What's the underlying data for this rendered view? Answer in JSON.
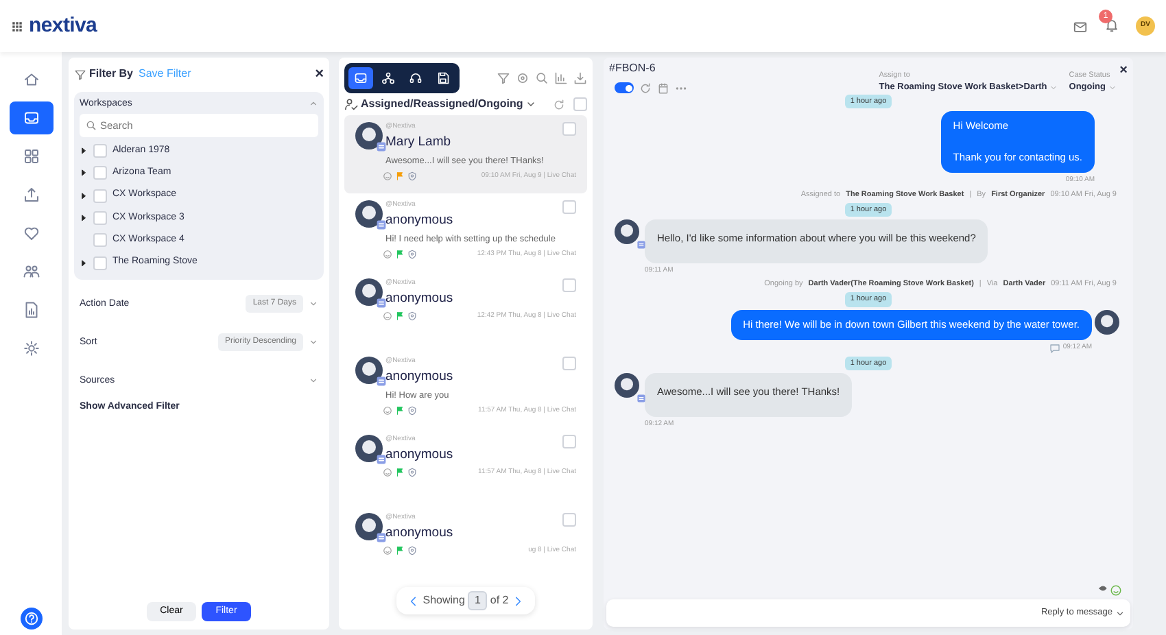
{
  "header": {
    "logo": "nextiva",
    "notifications": "1",
    "avatar": "DV"
  },
  "rail": {
    "items": [
      {
        "selected": false
      },
      {
        "selected": true
      },
      {
        "selected": false
      },
      {
        "selected": false
      },
      {
        "selected": false
      },
      {
        "selected": false
      },
      {
        "selected": false
      },
      {
        "selected": false
      }
    ]
  },
  "filter": {
    "title": "Filter By",
    "save": "Save Filter",
    "close": "×",
    "workspaces": {
      "title": "Workspaces",
      "expanded": true,
      "placeholder": "Search",
      "items": [
        {
          "label": "Alderan 1978",
          "expandable": true,
          "checked": false
        },
        {
          "label": "Arizona Team",
          "expandable": true,
          "checked": false
        },
        {
          "label": "CX Workspace",
          "expandable": true,
          "checked": false
        },
        {
          "label": "CX Workspace 3",
          "expandable": true,
          "checked": false
        },
        {
          "label": "CX Workspace 4",
          "expandable": false,
          "checked": false
        },
        {
          "label": "The Roaming Stove",
          "expandable": true,
          "checked": false
        }
      ]
    },
    "options": [
      {
        "label": "Action Date",
        "value": "Last 7 Days"
      },
      {
        "label": "Sort",
        "value": "Priority Descending"
      },
      {
        "label": "Sources"
      }
    ],
    "advanced": "Show Advanced Filter",
    "clear": "Clear",
    "apply": "Filter"
  },
  "list": {
    "tabs": [
      {
        "selected": true
      },
      {
        "selected": false
      },
      {
        "selected": false
      },
      {
        "selected": false
      }
    ],
    "view": "Assigned/Reassigned/Ongoing",
    "select_all_checked": false,
    "conversations": [
      {
        "source": "@Nextiva",
        "name": "Mary Lamb",
        "preview": "Awesome...I will see you there! THanks!",
        "color": "#f59e0b",
        "time": "09:10 AM Fri, Aug 9 | Live Chat",
        "selected": true,
        "checked": false
      },
      {
        "source": "@Nextiva",
        "name": "anonymous",
        "preview": "Hi! I need help with setting up the schedule",
        "color": "#22c55e",
        "time": "12:43 PM Thu, Aug 8 | Live Chat",
        "selected": false,
        "checked": false
      },
      {
        "source": "@Nextiva",
        "name": "anonymous",
        "color": "#22c55e",
        "time": "12:42 PM Thu, Aug 8 | Live Chat",
        "selected": false,
        "checked": false
      },
      {
        "source": "@Nextiva",
        "name": "anonymous",
        "preview": "Hi! How are you",
        "color": "#22c55e",
        "time": "11:57 AM Thu, Aug 8 | Live Chat",
        "selected": false,
        "checked": false
      },
      {
        "source": "@Nextiva",
        "name": "anonymous",
        "color": "#22c55e",
        "time": "11:57 AM Thu, Aug 8 | Live Chat",
        "selected": false,
        "checked": false
      },
      {
        "source": "@Nextiva",
        "name": "anonymous",
        "color": "#22c55e",
        "time": "ug 8 | Live Chat",
        "selected": false,
        "checked": false
      }
    ],
    "pager": {
      "label": "Showing",
      "page": "1",
      "total": "of 2"
    }
  },
  "chat": {
    "case": "#FBON-6",
    "close": "×",
    "live": true,
    "assign": {
      "label": "Assign to",
      "value": "The Roaming Stove Work Basket>Darth"
    },
    "status": {
      "label": "Case Status",
      "value": "Ongoing"
    },
    "messages": [
      {
        "kind": "divider",
        "text": "1 hour ago"
      },
      {
        "kind": "outgoing",
        "lines": [
          "Hi Welcome",
          "Thank you for contacting us."
        ],
        "time": "09:10 AM"
      },
      {
        "kind": "event",
        "parts": [
          {
            "kind": "label",
            "text": "Assigned to"
          },
          {
            "kind": "value",
            "text": "The Roaming Stove Work Basket"
          },
          {
            "kind": "label",
            "text": "|"
          },
          {
            "kind": "label",
            "text": "By"
          },
          {
            "kind": "value",
            "text": "First Organizer"
          },
          {
            "kind": "label",
            "text": "09:10 AM Fri, Aug 9"
          }
        ]
      },
      {
        "kind": "divider",
        "text": "1 hour ago"
      },
      {
        "kind": "incoming",
        "lines": [
          "Hello, I'd like some information about where you will be this weekend?"
        ],
        "time": "09:11 AM"
      },
      {
        "kind": "event",
        "parts": [
          {
            "kind": "label",
            "text": "Ongoing by"
          },
          {
            "kind": "value",
            "text": "Darth Vader(The Roaming Stove Work Basket)"
          },
          {
            "kind": "label",
            "text": "|"
          },
          {
            "kind": "label",
            "text": "Via"
          },
          {
            "kind": "value",
            "text": "Darth Vader"
          },
          {
            "kind": "label",
            "text": "09:11 AM Fri, Aug 9"
          }
        ]
      },
      {
        "kind": "divider",
        "text": "1 hour ago"
      },
      {
        "kind": "outgoing",
        "lines": [
          "Hi there! We will be in down town Gilbert this weekend by the water tower."
        ],
        "time": "09:12 AM",
        "avatar": true
      },
      {
        "kind": "divider",
        "text": "1 hour ago"
      },
      {
        "kind": "incoming",
        "lines": [
          "Awesome...I will see you there! THanks!"
        ],
        "time": "09:12 AM"
      }
    ],
    "reply": "Reply to message"
  }
}
